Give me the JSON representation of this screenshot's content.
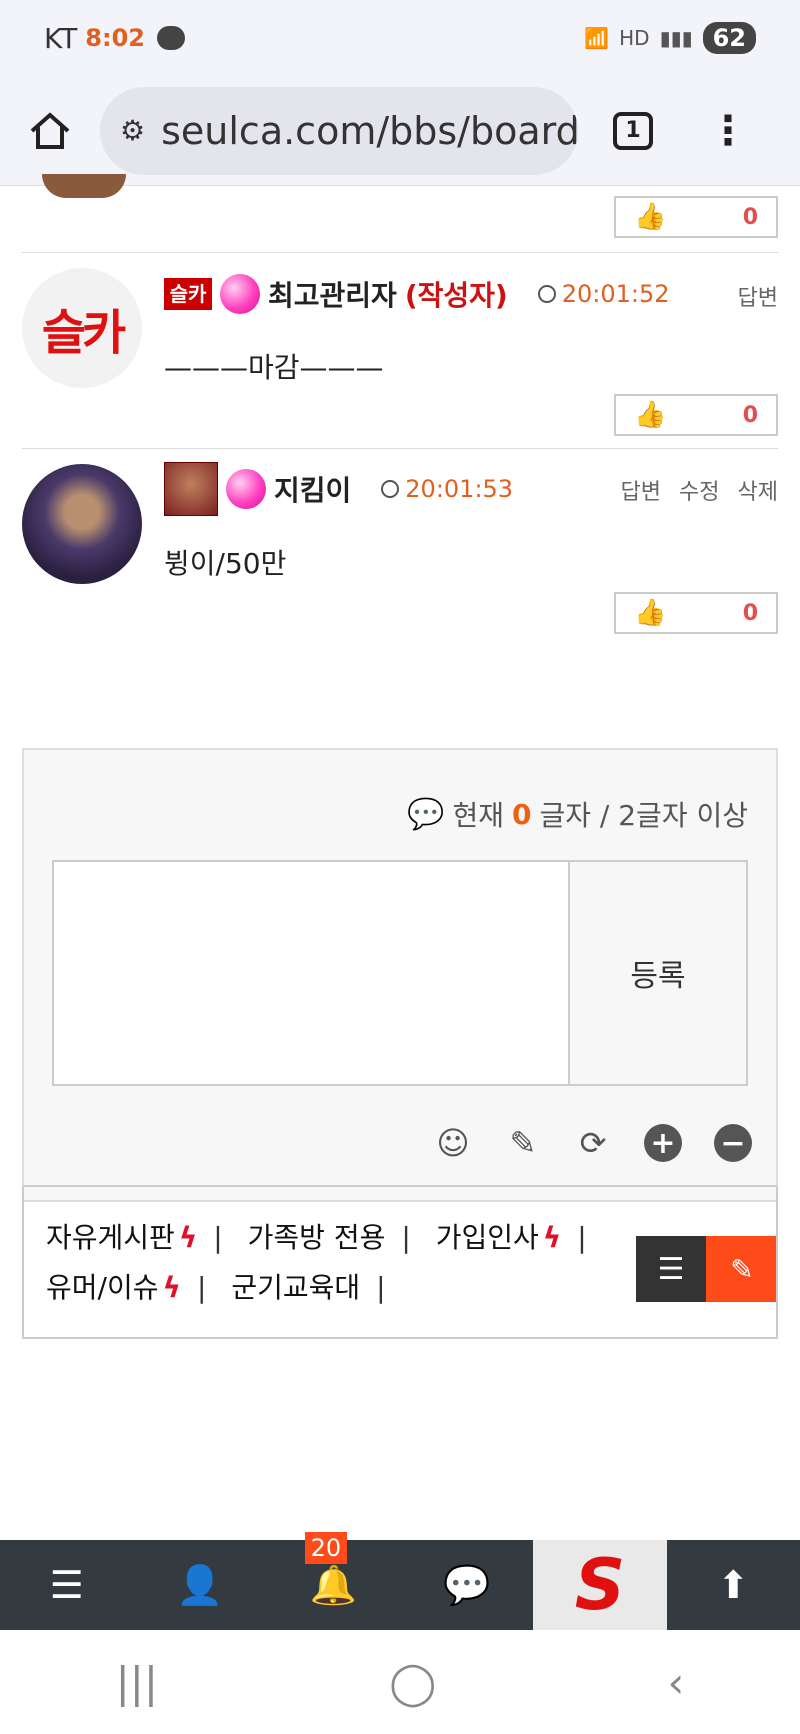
{
  "status": {
    "carrier": "KT",
    "time": "8:02",
    "hd": "HD",
    "battery": "62"
  },
  "browser": {
    "url": "seulca.com/bbs/board",
    "tab_count": "1"
  },
  "comments": [
    {
      "likes": "0"
    },
    {
      "level_tag": "슬카",
      "nick": "최고관리자",
      "author_tag": "(작성자)",
      "time": "20:01:52",
      "actions": [
        "답변"
      ],
      "body": "———마감———",
      "likes": "0"
    },
    {
      "nick": "지킴이",
      "time": "20:01:53",
      "actions": [
        "답변",
        "수정",
        "삭제"
      ],
      "body": "뷩이/50만",
      "likes": "0"
    }
  ],
  "write": {
    "count_prefix": "현재 ",
    "count_value": "0",
    "count_suffix": "글자 / 2글자 이상",
    "submit_label": "등록"
  },
  "board_links": [
    "자유게시판",
    "가족방 전용",
    "가입인사",
    "유머/이슈",
    "군기교육대"
  ],
  "bottom_nav": {
    "notif_count": "20"
  },
  "colors": {
    "accent": "#ff4a1a",
    "time": "#e06020",
    "author": "#d01010"
  }
}
